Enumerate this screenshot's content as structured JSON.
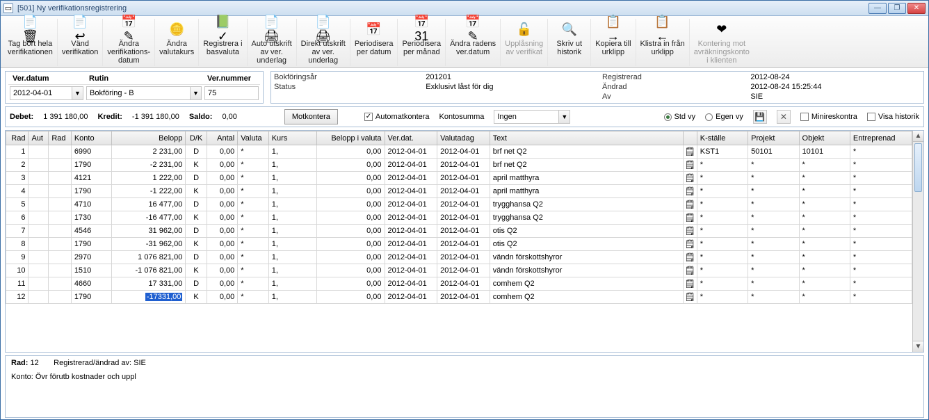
{
  "window": {
    "title": "[501]  Ny verifikationsregistrering"
  },
  "winbtns": {
    "min": "—",
    "max": "❐",
    "close": "✕"
  },
  "tools": [
    {
      "icon": "📄🗑",
      "label": "Tag bort hela\nverifikationen",
      "enabled": true
    },
    {
      "icon": "📄↩",
      "label": "Vänd\nverifikation",
      "enabled": true
    },
    {
      "icon": "📅✎",
      "label": "Ändra\nverifikations-\ndatum",
      "enabled": true
    },
    {
      "icon": "🪙",
      "label": "Ändra\nvalutakurs",
      "enabled": true
    },
    {
      "icon": "📗✓",
      "label": "Registrera i\nbasvaluta",
      "enabled": true
    },
    {
      "icon": "📄🖨",
      "label": "Auto utskrift\nav ver.\nunderlag",
      "enabled": true
    },
    {
      "icon": "📄🖨",
      "label": "Direkt utskrift\nav ver.\nunderlag",
      "enabled": true
    },
    {
      "icon": "📅",
      "label": "Periodisera\nper datum",
      "enabled": true
    },
    {
      "icon": "📅31",
      "label": "Periodisera\nper månad",
      "enabled": true
    },
    {
      "icon": "📅✎",
      "label": "Ändra radens\nver.datum",
      "enabled": true
    },
    {
      "icon": "🔓",
      "label": "Upplåsning\nav verifikat",
      "enabled": false
    },
    {
      "icon": "🔍",
      "label": "Skriv ut\nhistorik",
      "enabled": true
    },
    {
      "icon": "📋→",
      "label": "Kopiera till\nurklipp",
      "enabled": true
    },
    {
      "icon": "📋←",
      "label": "Klistra in från\nurklipp",
      "enabled": true
    },
    {
      "icon": "❤",
      "label": "Kontering mot\navräkningskonto\ni klienten",
      "enabled": false
    }
  ],
  "header": {
    "verdatum_lbl": "Ver.datum",
    "verdatum_val": "2012-04-01",
    "rutin_lbl": "Rutin",
    "rutin_val": "Bokföring - B",
    "vernr_lbl": "Ver.nummer",
    "vernr_val": "75"
  },
  "info": {
    "bokforingsar_lbl": "Bokföringsår",
    "bokforingsar_val": "201201",
    "status_lbl": "Status",
    "status_val": "Exklusivt låst för dig",
    "registrerad_lbl": "Registrerad",
    "registrerad_val": "2012-08-24",
    "andrad_lbl": "Ändrad",
    "andrad_val": "2012-08-24 15:25:44",
    "av_lbl": "Av",
    "av_val": "SIE"
  },
  "sum": {
    "debet_lbl": "Debet:",
    "debet_val": "1 391 180,00",
    "kredit_lbl": "Kredit:",
    "kredit_val": "-1 391 180,00",
    "saldo_lbl": "Saldo:",
    "saldo_val": "0,00",
    "motkontera": "Motkontera",
    "automatkontera": "Automatkontera",
    "kontosumma_lbl": "Kontosumma",
    "kontosumma_val": "Ingen",
    "stdvy": "Std vy",
    "egenvy": "Egen vy",
    "minireskontra": "Minireskontra",
    "visahistorik": "Visa historik"
  },
  "cols": {
    "rad": "Rad",
    "aut": "Aut",
    "rad2": "Rad",
    "konto": "Konto",
    "belopp": "Belopp",
    "dk": "D/K",
    "antal": "Antal",
    "valuta": "Valuta",
    "kurs": "Kurs",
    "beloppvaluta": "Belopp i valuta",
    "verdat": "Ver.dat.",
    "valutadag": "Valutadag",
    "text": "Text",
    "note": "",
    "kstalle": "K-ställe",
    "projekt": "Projekt",
    "objekt": "Objekt",
    "entreprenad": "Entreprenad"
  },
  "rows": [
    {
      "rad": "1",
      "konto": "6990",
      "belopp": "2 231,00",
      "dk": "D",
      "antal": "0,00",
      "valuta": "*",
      "kurs": "1,",
      "biv": "0,00",
      "verd": "2012-04-01",
      "vald": "2012-04-01",
      "text": "brf net Q2",
      "kst": "KST1",
      "proj": "50101",
      "obj": "10101",
      "ent": "*"
    },
    {
      "rad": "2",
      "konto": "1790",
      "belopp": "-2 231,00",
      "dk": "K",
      "antal": "0,00",
      "valuta": "*",
      "kurs": "1,",
      "biv": "0,00",
      "verd": "2012-04-01",
      "vald": "2012-04-01",
      "text": "brf net Q2",
      "kst": "*",
      "proj": "*",
      "obj": "*",
      "ent": "*"
    },
    {
      "rad": "3",
      "konto": "4121",
      "belopp": "1 222,00",
      "dk": "D",
      "antal": "0,00",
      "valuta": "*",
      "kurs": "1,",
      "biv": "0,00",
      "verd": "2012-04-01",
      "vald": "2012-04-01",
      "text": "april matthyra",
      "kst": "*",
      "proj": "*",
      "obj": "*",
      "ent": "*"
    },
    {
      "rad": "4",
      "konto": "1790",
      "belopp": "-1 222,00",
      "dk": "K",
      "antal": "0,00",
      "valuta": "*",
      "kurs": "1,",
      "biv": "0,00",
      "verd": "2012-04-01",
      "vald": "2012-04-01",
      "text": "april matthyra",
      "kst": "*",
      "proj": "*",
      "obj": "*",
      "ent": "*"
    },
    {
      "rad": "5",
      "konto": "4710",
      "belopp": "16 477,00",
      "dk": "D",
      "antal": "0,00",
      "valuta": "*",
      "kurs": "1,",
      "biv": "0,00",
      "verd": "2012-04-01",
      "vald": "2012-04-01",
      "text": "trygghansa Q2",
      "kst": "*",
      "proj": "*",
      "obj": "*",
      "ent": "*"
    },
    {
      "rad": "6",
      "konto": "1730",
      "belopp": "-16 477,00",
      "dk": "K",
      "antal": "0,00",
      "valuta": "*",
      "kurs": "1,",
      "biv": "0,00",
      "verd": "2012-04-01",
      "vald": "2012-04-01",
      "text": "trygghansa Q2",
      "kst": "*",
      "proj": "*",
      "obj": "*",
      "ent": "*"
    },
    {
      "rad": "7",
      "konto": "4546",
      "belopp": "31 962,00",
      "dk": "D",
      "antal": "0,00",
      "valuta": "*",
      "kurs": "1,",
      "biv": "0,00",
      "verd": "2012-04-01",
      "vald": "2012-04-01",
      "text": "otis Q2",
      "kst": "*",
      "proj": "*",
      "obj": "*",
      "ent": "*"
    },
    {
      "rad": "8",
      "konto": "1790",
      "belopp": "-31 962,00",
      "dk": "K",
      "antal": "0,00",
      "valuta": "*",
      "kurs": "1,",
      "biv": "0,00",
      "verd": "2012-04-01",
      "vald": "2012-04-01",
      "text": "otis Q2",
      "kst": "*",
      "proj": "*",
      "obj": "*",
      "ent": "*"
    },
    {
      "rad": "9",
      "konto": "2970",
      "belopp": "1 076 821,00",
      "dk": "D",
      "antal": "0,00",
      "valuta": "*",
      "kurs": "1,",
      "biv": "0,00",
      "verd": "2012-04-01",
      "vald": "2012-04-01",
      "text": "vändn förskottshyror",
      "kst": "*",
      "proj": "*",
      "obj": "*",
      "ent": "*"
    },
    {
      "rad": "10",
      "konto": "1510",
      "belopp": "-1 076 821,00",
      "dk": "K",
      "antal": "0,00",
      "valuta": "*",
      "kurs": "1,",
      "biv": "0,00",
      "verd": "2012-04-01",
      "vald": "2012-04-01",
      "text": "vändn förskottshyror",
      "kst": "*",
      "proj": "*",
      "obj": "*",
      "ent": "*"
    },
    {
      "rad": "11",
      "konto": "4660",
      "belopp": "17 331,00",
      "dk": "D",
      "antal": "0,00",
      "valuta": "*",
      "kurs": "1,",
      "biv": "0,00",
      "verd": "2012-04-01",
      "vald": "2012-04-01",
      "text": "comhem Q2",
      "kst": "*",
      "proj": "*",
      "obj": "*",
      "ent": "*"
    },
    {
      "rad": "12",
      "konto": "1790",
      "belopp": "-17331,00",
      "dk": "K",
      "antal": "0,00",
      "valuta": "*",
      "kurs": "1,",
      "biv": "0,00",
      "verd": "2012-04-01",
      "vald": "2012-04-01",
      "text": "comhem Q2",
      "kst": "*",
      "proj": "*",
      "obj": "*",
      "ent": "*",
      "editing": true
    }
  ],
  "footer": {
    "rad_lbl": "Rad:",
    "rad_val": "12",
    "regav_lbl": "Registrerad/ändrad av:",
    "regav_val": "SIE",
    "konto_lbl": "Konto:",
    "konto_val": "Övr förutb kostnader och uppl"
  }
}
